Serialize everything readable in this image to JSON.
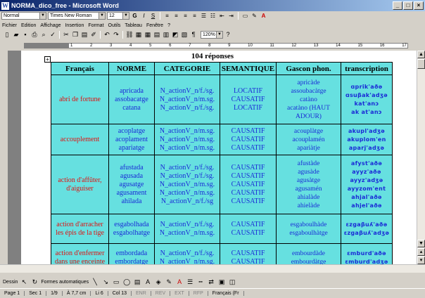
{
  "window": {
    "title": "NORMA_dico_free - Microsoft Word",
    "app_icon": "W"
  },
  "format_bar": {
    "style": "Normal",
    "font": "Times New Roman",
    "size": "12",
    "bold": "G",
    "italic": "I",
    "underline": "S"
  },
  "menu": [
    "Fichier",
    "Edition",
    "Affichage",
    "Insertion",
    "Format",
    "Outils",
    "Tableau",
    "Fenêtre",
    "?"
  ],
  "standard_bar": {
    "zoom": "120%"
  },
  "ruler": {
    "ticks": [
      "1",
      "2",
      "3",
      "4",
      "5",
      "6",
      "7",
      "8",
      "9",
      "10",
      "11",
      "12",
      "13",
      "14",
      "15",
      "16",
      "17"
    ]
  },
  "document": {
    "heading": "104 réponses",
    "columns": [
      "Français",
      "NORME",
      "CATEGORIE",
      "SEMANTIQUE",
      "Gascon phon.",
      "transcription"
    ],
    "rows": [
      {
        "fr": "abri de fortune",
        "norme": [
          "apricada",
          "assobacatge",
          "catana"
        ],
        "cat": [
          "N_actionV_n/f./sg.",
          "N_actionV_n/m.sg.",
          "N_actionV_n/f./sg."
        ],
        "sem": [
          "LOCATIF",
          "CAUSATIF",
          "LOCATIF"
        ],
        "gp": [
          "apricàde",
          "assoubacàtge",
          "catàno",
          "acatàno (HAUT ADOUR)"
        ],
        "tr": [
          "ɑprik'aðə",
          "ɑsuβak'adʒə",
          "kat'anɔ",
          "ak at'anɔ"
        ]
      },
      {
        "fr": "accouplement",
        "norme": [
          "acoplatge",
          "acoplament",
          "apariatge"
        ],
        "cat": [
          "N_actionV_n/m.sg.",
          "N_actionV_n/m.sg.",
          "N_actionV_n/m.sg."
        ],
        "sem": [
          "CAUSATIF",
          "CAUSATIF",
          "CAUSATIF"
        ],
        "gp": [
          "acouplàtge",
          "acouplamén",
          "apariàtje"
        ],
        "tr": [
          "akupl'adʒə",
          "akuplom'en",
          "aparj'adʒə"
        ]
      },
      {
        "fr": "action d'affûter, d'aiguiser",
        "norme": [
          "afustada",
          "agusada",
          "agusatge",
          "agusament",
          "ahilada"
        ],
        "cat": [
          "N_actionV_n/f./sg.",
          "N_actionV_n/f./sg.",
          "N_actionV_n/m.sg.",
          "N_actionV_n/m.sg.",
          "N_actionV_n/f./sg"
        ],
        "sem": [
          "CAUSATIF",
          "CAUSATIF",
          "CAUSATIF",
          "CAUSATIF",
          "CAUSATIF"
        ],
        "gp": [
          "afustàde",
          "agusàde",
          "agusàtge",
          "agusamén",
          "ahialàde",
          "ahielàde"
        ],
        "tr": [
          "afyst'aðə",
          "ayyz'aðə",
          "ayyz'adʒə",
          "ayyzom'ent",
          "ahjal'aðə",
          "ahjel'aðə"
        ]
      },
      {
        "fr": "action d'arracher les épis de la tige",
        "norme": [
          "esgabolhada",
          "esgabolhatge"
        ],
        "cat": [
          "N_actionV_n/f./sg.",
          "N_actionV_n/m.sg."
        ],
        "sem": [
          "CAUSATIF",
          "CAUSATIF"
        ],
        "gp": [
          "esgaboulhàde",
          "esgaboulhàtge"
        ],
        "tr": [
          "ɛzgaβuʎ'aðə",
          "ɛzgaβuʎ'adʒə"
        ]
      },
      {
        "fr": "action d'enfermer dans une enceinte",
        "norme": [
          "embordada",
          "embordatge"
        ],
        "cat": [
          "N_actionV_n/f./sg.",
          "N_actionV_n/m.sg."
        ],
        "sem": [
          "CAUSATIF",
          "CAUSATIF"
        ],
        "gp": [
          "embourdàde",
          "embourdàtge"
        ],
        "tr": [
          "ɛmburd'aðə",
          "ɛmburd'adʒə"
        ]
      }
    ]
  },
  "draw_bar": {
    "draw": "Dessin",
    "autoshapes": "Formes automatiques"
  },
  "status": {
    "page": "Page 1",
    "sec": "Sec 1",
    "pages": "1/9",
    "at": "À 7,7 cm",
    "line": "Li 6",
    "col": "Col 13",
    "modes": [
      "ENR",
      "REV",
      "EXT",
      "RFP"
    ],
    "lang": "Français (Fr"
  },
  "colors": {
    "table_bg": "#66e0e0",
    "french": "#e01010",
    "entries": "#1a2ad6",
    "title_gradient": "#0a246a"
  }
}
